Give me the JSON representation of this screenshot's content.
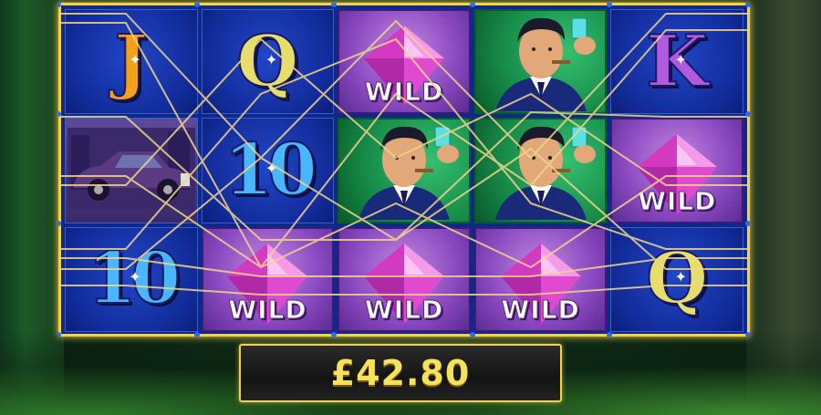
{
  "reels": {
    "columns": [
      [
        {
          "symbol": "J",
          "kind": "letter",
          "icon": "jack-card-icon"
        },
        {
          "symbol": "car",
          "kind": "car",
          "icon": "vintage-car-icon"
        },
        {
          "symbol": "10",
          "kind": "letter",
          "icon": "ten-card-icon"
        }
      ],
      [
        {
          "symbol": "Q",
          "kind": "letter",
          "icon": "queen-card-icon"
        },
        {
          "symbol": "10",
          "kind": "letter",
          "icon": "ten-card-icon"
        },
        {
          "symbol": "WILD",
          "kind": "wild",
          "icon": "pink-diamond-icon"
        }
      ],
      [
        {
          "symbol": "WILD",
          "kind": "wild",
          "icon": "pink-diamond-icon"
        },
        {
          "symbol": "gangster",
          "kind": "man",
          "icon": "gangster-with-diamond-icon"
        },
        {
          "symbol": "WILD",
          "kind": "wild",
          "icon": "pink-diamond-icon"
        }
      ],
      [
        {
          "symbol": "gangster",
          "kind": "man",
          "icon": "gangster-with-diamond-icon"
        },
        {
          "symbol": "gangster",
          "kind": "man",
          "icon": "gangster-with-diamond-icon"
        },
        {
          "symbol": "WILD",
          "kind": "wild",
          "icon": "pink-diamond-icon"
        }
      ],
      [
        {
          "symbol": "K",
          "kind": "letter",
          "icon": "king-card-icon"
        },
        {
          "symbol": "WILD",
          "kind": "wild",
          "icon": "pink-diamond-icon"
        },
        {
          "symbol": "Q",
          "kind": "letter",
          "icon": "queen-card-icon"
        }
      ]
    ]
  },
  "win": {
    "amount": "£42.80"
  },
  "colors": {
    "frame": "#f3d24a",
    "reel_bg": "#122c9a",
    "wild_bg": "#8a48c0",
    "man_bg": "#168a48",
    "win_text": "#f6e25a"
  }
}
